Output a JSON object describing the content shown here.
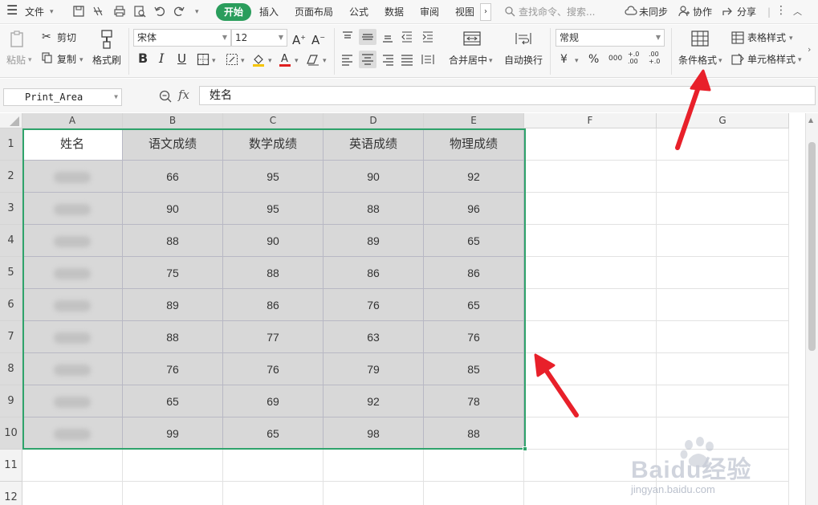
{
  "menubar": {
    "file_label": "文件",
    "tabs": [
      "开始",
      "插入",
      "页面布局",
      "公式",
      "数据",
      "审阅",
      "视图"
    ],
    "search_placeholder": "查找命令、搜索...",
    "sync_label": "未同步",
    "collab_label": "协作",
    "share_label": "分享"
  },
  "ribbon": {
    "paste_label": "粘贴",
    "cut_label": "剪切",
    "copy_label": "复制",
    "format_painter_label": "格式刷",
    "font_name": "宋体",
    "font_size": "12",
    "merge_center_label": "合并居中",
    "wrap_text_label": "自动换行",
    "number_format": "常规",
    "currency_symbol": "¥",
    "percent_symbol": "%",
    "thousands_symbol": "000",
    "inc_decimal_symbol": "+.0 .00",
    "dec_decimal_symbol": ".00 +.0",
    "conditional_format_label": "条件格式",
    "table_style_label": "表格样式",
    "cell_style_label": "单元格样式"
  },
  "formula_bar": {
    "name_box": "Print_Area",
    "fx_label": "fx",
    "formula_value": "姓名"
  },
  "sheet": {
    "columns": [
      "A",
      "B",
      "C",
      "D",
      "E",
      "F",
      "G"
    ],
    "selected_columns": [
      "A",
      "B",
      "C",
      "D",
      "E"
    ],
    "row_numbers": [
      "1",
      "2",
      "3",
      "4",
      "5",
      "6",
      "7",
      "8",
      "9",
      "10",
      "11",
      "12"
    ],
    "header_row": [
      "姓名",
      "语文成绩",
      "数学成绩",
      "英语成绩",
      "物理成绩"
    ],
    "data_rows": [
      [
        "66",
        "95",
        "90",
        "92"
      ],
      [
        "90",
        "95",
        "88",
        "96"
      ],
      [
        "88",
        "90",
        "89",
        "65"
      ],
      [
        "75",
        "88",
        "86",
        "86"
      ],
      [
        "89",
        "86",
        "76",
        "65"
      ],
      [
        "88",
        "77",
        "63",
        "76"
      ],
      [
        "76",
        "76",
        "79",
        "85"
      ],
      [
        "65",
        "69",
        "92",
        "78"
      ],
      [
        "99",
        "65",
        "98",
        "88"
      ]
    ]
  },
  "colors": {
    "accent_green": "#2a9d5c",
    "selection_border": "#2fa36b",
    "arrow_red": "#e8202a",
    "selected_fill": "#d8d8d8"
  },
  "watermark": {
    "brand": "Baidu经验",
    "url": "jingyan.baidu.com"
  }
}
